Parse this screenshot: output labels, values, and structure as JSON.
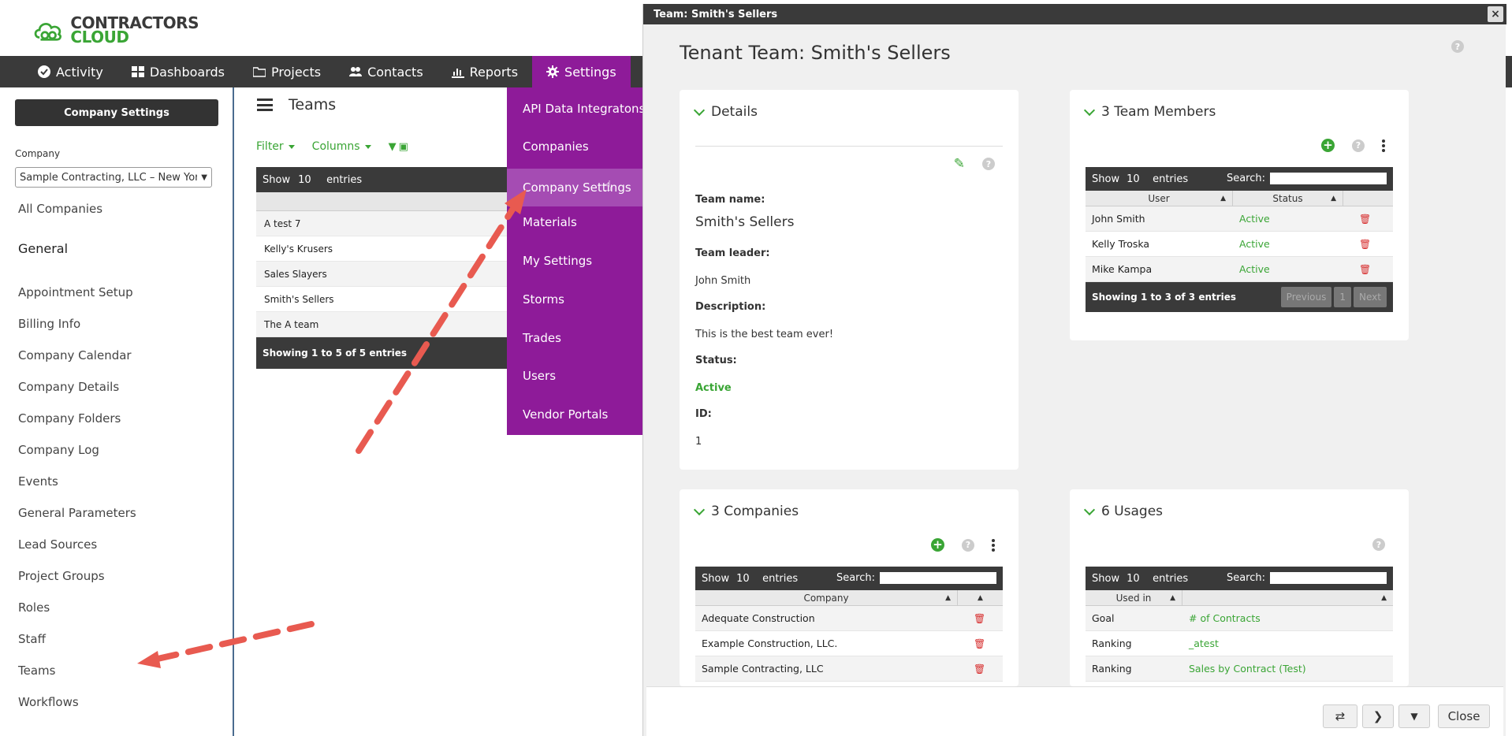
{
  "logo": {
    "word1": "CONTRACTORS",
    "word2": "CLOUD"
  },
  "nav": [
    {
      "label": "Activity",
      "icon": "check-circle-icon"
    },
    {
      "label": "Dashboards",
      "icon": "grid-icon"
    },
    {
      "label": "Projects",
      "icon": "folder-icon"
    },
    {
      "label": "Contacts",
      "icon": "users-icon"
    },
    {
      "label": "Reports",
      "icon": "bar-chart-icon"
    },
    {
      "label": "Settings",
      "icon": "gear-icon",
      "active": true
    }
  ],
  "sidebar": {
    "button": "Company Settings",
    "company_label": "Company",
    "company_value": "Sample Contracting, LLC – New York",
    "all_companies": "All Companies",
    "section": "General",
    "links": [
      "Appointment Setup",
      "Billing Info",
      "Company Calendar",
      "Company Details",
      "Company Folders",
      "Company Log",
      "Events",
      "General Parameters",
      "Lead Sources",
      "Project Groups",
      "Roles",
      "Staff",
      "Teams",
      "Workflows"
    ]
  },
  "main": {
    "title": "Teams",
    "filter": "Filter",
    "columns": "Columns",
    "show": "Show",
    "show_value": "10",
    "entries": "entries",
    "rows": [
      "A test 7",
      "Kelly's Krusers",
      "Sales Slayers",
      "Smith's Sellers",
      "The A team"
    ],
    "footer": "Showing 1 to 5 of 5 entries"
  },
  "settings_menu": [
    "API Data Integratons",
    "Companies",
    "Company Settings",
    "Materials",
    "My Settings",
    "Storms",
    "Trades",
    "Users",
    "Vendor Portals"
  ],
  "modal": {
    "titlebar": "Team: Smith's Sellers",
    "close_x": "×",
    "heading": "Tenant Team: Smith's Sellers",
    "details": {
      "title": "Details",
      "team_name_label": "Team name:",
      "team_name": "Smith's Sellers",
      "leader_label": "Team leader:",
      "leader": "John Smith",
      "desc_label": "Description:",
      "desc": "This is the best team ever!",
      "status_label": "Status:",
      "status": "Active",
      "id_label": "ID:",
      "id": "1"
    },
    "members": {
      "title": "3 Team Members",
      "show": "Show",
      "show_value": "10",
      "entries": "entries",
      "search": "Search:",
      "col_user": "User",
      "col_status": "Status",
      "rows": [
        {
          "user": "John Smith",
          "status": "Active"
        },
        {
          "user": "Kelly Troska",
          "status": "Active"
        },
        {
          "user": "Mike Kampa",
          "status": "Active"
        }
      ],
      "footer": "Showing 1 to 3 of 3 entries",
      "prev": "Previous",
      "page": "1",
      "next": "Next"
    },
    "companies": {
      "title": "3 Companies",
      "show": "Show",
      "show_value": "10",
      "entries": "entries",
      "search": "Search:",
      "col_company": "Company",
      "rows": [
        "Adequate Construction",
        "Example Construction, LLC.",
        "Sample Contracting, LLC"
      ]
    },
    "usages": {
      "title": "6 Usages",
      "show": "Show",
      "show_value": "10",
      "entries": "entries",
      "search": "Search:",
      "col_used": "Used in",
      "rows": [
        {
          "used": "Goal",
          "name": "# of Contracts"
        },
        {
          "used": "Ranking",
          "name": "_atest"
        },
        {
          "used": "Ranking",
          "name": "Sales by Contract (Test)"
        }
      ]
    },
    "footer": {
      "close": "Close"
    }
  },
  "colors": {
    "accent_green": "#3aa535",
    "settings_purple": "#8e1b99",
    "dark_bar": "#3a3a3a",
    "annotation_red": "#e85a50"
  }
}
